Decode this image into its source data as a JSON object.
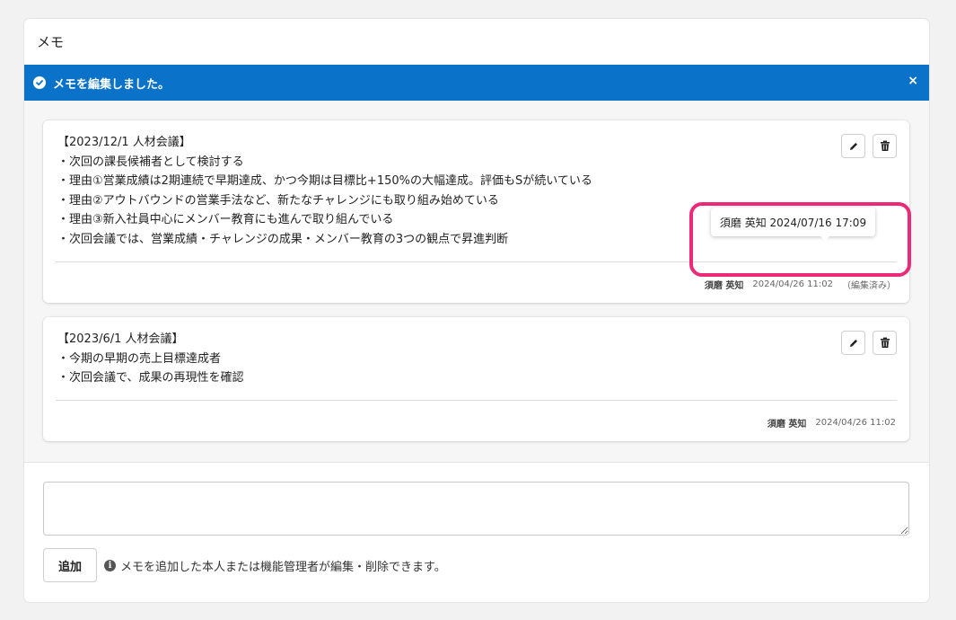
{
  "panel": {
    "title": "メモ"
  },
  "banner": {
    "message": "メモを編集しました。",
    "close_glyph": "×",
    "color": "#0a72c8"
  },
  "memos": [
    {
      "lines": [
        "【2023/12/1 人材会議】",
        "・次回の課長候補者として検討する",
        "・理由①営業成績は2期連続で早期達成、かつ今期は目標比+150%の大幅達成。評価もSが続いている",
        "・理由②アウトバウンドの営業手法など、新たなチャレンジにも取り組み始めている",
        "・理由③新入社員中心にメンバー教育にも進んで取り組んでいる",
        "・次回会議では、営業成績・チャレンジの成果・メンバー教育の3つの観点で昇進判断"
      ],
      "author": "須磨 英知",
      "date": "2024/04/26 11:02",
      "edited_label": "（編集済み）",
      "tooltip": "須磨 英知 2024/07/16 17:09"
    },
    {
      "lines": [
        "【2023/6/1 人材会議】",
        "・今期の早期の売上目標達成者",
        "・次回会議で、成果の再現性を確認"
      ],
      "author": "須磨 英知",
      "date": "2024/04/26 11:02"
    }
  ],
  "composer": {
    "input_value": "",
    "add_label": "追加",
    "note": "メモを追加した本人または機能管理者が編集・削除できます。",
    "info_glyph": "i"
  },
  "icons": {
    "edit": "pencil-icon",
    "delete": "trash-icon",
    "check": "check-circle-icon",
    "info": "info-icon"
  },
  "colors": {
    "highlight": "#ec2a77",
    "background": "#f2f2f2"
  }
}
